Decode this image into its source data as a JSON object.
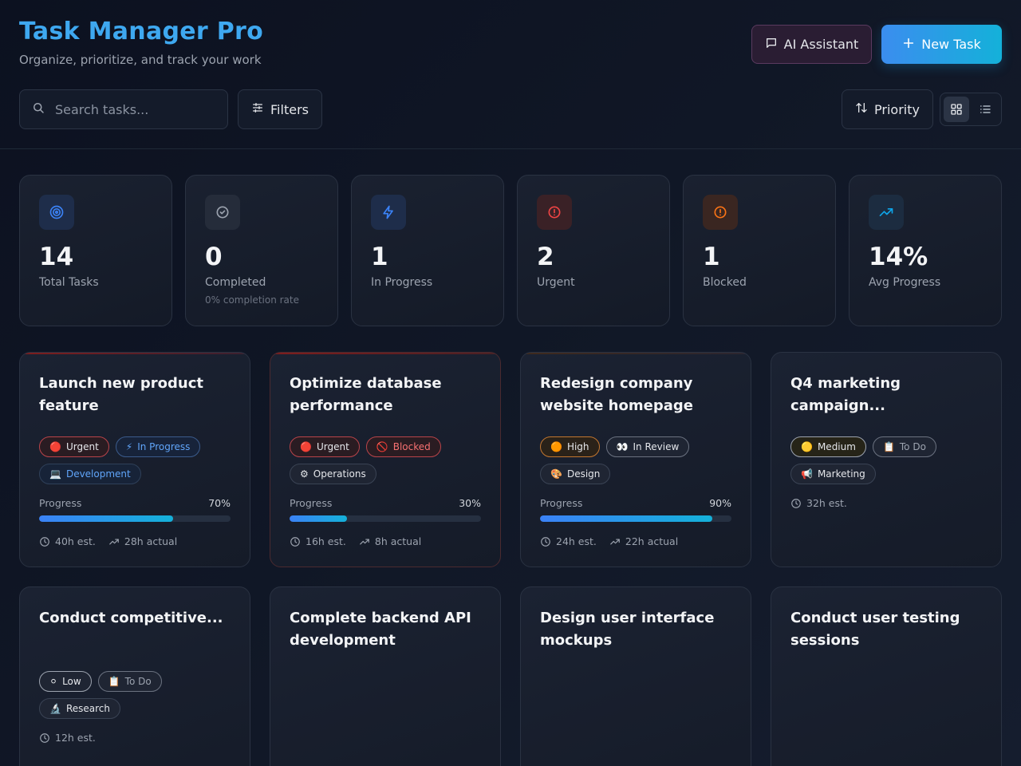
{
  "header": {
    "title": "Task Manager Pro",
    "subtitle": "Organize, prioritize, and track your work",
    "ai_label": "AI Assistant",
    "new_task_label": "New Task"
  },
  "toolbar": {
    "search_placeholder": "Search tasks...",
    "filters_label": "Filters",
    "sort_label": "Priority",
    "view_mode": "grid"
  },
  "stats": [
    {
      "value": "14",
      "label": "Total Tasks",
      "sub": "",
      "icon": "target-icon",
      "color": "#3b82f6"
    },
    {
      "value": "0",
      "label": "Completed",
      "sub": "0% completion rate",
      "icon": "check-circle-icon",
      "color": "#9ca3af"
    },
    {
      "value": "1",
      "label": "In Progress",
      "sub": "",
      "icon": "bolt-icon",
      "color": "#3b82f6"
    },
    {
      "value": "2",
      "label": "Urgent",
      "sub": "",
      "icon": "alert-circle-icon",
      "color": "#ef4444"
    },
    {
      "value": "1",
      "label": "Blocked",
      "sub": "",
      "icon": "alert-circle-icon",
      "color": "#f97316"
    },
    {
      "value": "14%",
      "label": "Avg Progress",
      "sub": "",
      "icon": "trending-up-icon",
      "color": "#0ea5e9"
    }
  ],
  "tasks": [
    {
      "title": "Launch new product feature",
      "priority": {
        "emoji": "🔴",
        "label": "Urgent"
      },
      "status": {
        "emoji": "⚡",
        "label": "In Progress"
      },
      "category": {
        "emoji": "💻",
        "label": "Development"
      },
      "progress_label": "Progress",
      "progress": 70,
      "progress_text": "70%",
      "estimate": "40h est.",
      "actual": "28h actual"
    },
    {
      "title": "Optimize database performance",
      "priority": {
        "emoji": "🔴",
        "label": "Urgent"
      },
      "status": {
        "emoji": "🚫",
        "label": "Blocked"
      },
      "category": {
        "emoji": "⚙",
        "label": "Operations"
      },
      "progress_label": "Progress",
      "progress": 30,
      "progress_text": "30%",
      "estimate": "16h est.",
      "actual": "8h actual"
    },
    {
      "title": "Redesign company website homepage",
      "priority": {
        "emoji": "🟠",
        "label": "High"
      },
      "status": {
        "emoji": "👀",
        "label": "In Review"
      },
      "category": {
        "emoji": "🎨",
        "label": "Design"
      },
      "progress_label": "Progress",
      "progress": 90,
      "progress_text": "90%",
      "estimate": "24h est.",
      "actual": "22h actual"
    },
    {
      "title": "Q4 marketing campaign...",
      "priority": {
        "emoji": "🟡",
        "label": "Medium"
      },
      "status": {
        "emoji": "📋",
        "label": "To Do"
      },
      "category": {
        "emoji": "📢",
        "label": "Marketing"
      },
      "estimate": "32h est."
    },
    {
      "title": "Conduct competitive...",
      "priority": {
        "emoji": "⚪",
        "label": "Low"
      },
      "status": {
        "emoji": "📋",
        "label": "To Do"
      },
      "category": {
        "emoji": "🔬",
        "label": "Research"
      },
      "estimate": "12h est."
    },
    {
      "title": "Complete backend API development"
    },
    {
      "title": "Design user interface mockups"
    },
    {
      "title": "Conduct user testing sessions"
    }
  ]
}
